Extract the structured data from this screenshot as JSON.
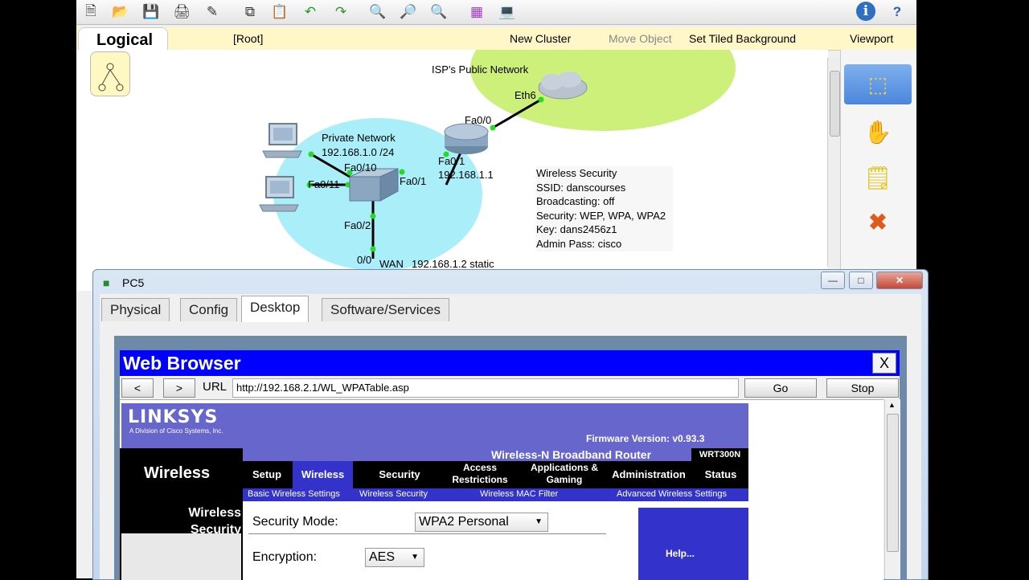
{
  "toolbar": {
    "icons": [
      "new-icon",
      "open-icon",
      "save-icon",
      "print-icon",
      "wizard-icon",
      "copy-icon",
      "paste-icon",
      "undo-icon",
      "redo-icon",
      "zoom-in-icon",
      "zoom-reset-icon",
      "zoom-out-icon",
      "palette-icon",
      "device-icon",
      "info-icon",
      "help-icon"
    ]
  },
  "navbar": {
    "mode": "Logical",
    "root": "[Root]",
    "new_cluster": "New Cluster",
    "move_object": "Move Object",
    "set_tiled_background": "Set Tiled Background",
    "viewport": "Viewport"
  },
  "topology": {
    "isp_label": "ISP's Public Network",
    "eth6": "Eth6",
    "fa00": "Fa0/0",
    "fa01_router": "Fa0/1",
    "router_ip": "192.168.1.1",
    "private_network": "Private Network",
    "private_subnet": "192.168.1.0 /24",
    "fa010": "Fa0/10",
    "fa011": "Fa0/11",
    "fa01_switch": "Fa0/1",
    "fa02": "Fa0/2",
    "port00": "0/0",
    "wan_label": "WAN",
    "wan_ip": "192.168.1.2 static",
    "wireless_info": [
      "Wireless Security",
      "SSID: danscourses",
      "Broadcasting: off",
      "Security: WEP, WPA, WPA2",
      "Key: dans2456z1",
      "Admin Pass: cisco"
    ],
    "colors": {
      "isp_cloud": "#ccf07a",
      "private_cloud": "#aaeefa",
      "link_dot": "#22dd22"
    }
  },
  "pc_window": {
    "title": "PC5",
    "tabs": [
      "Physical",
      "Config",
      "Desktop",
      "Software/Services"
    ],
    "active_tab": "Desktop"
  },
  "browser": {
    "title": "Web Browser",
    "close_label": "X",
    "back_label": "<",
    "forward_label": ">",
    "url_label": "URL",
    "url": "http://192.168.2.1/WL_WPATable.asp",
    "go_label": "Go",
    "stop_label": "Stop"
  },
  "linksys": {
    "logo": "LINKSYS",
    "logo_sub": "A Division of Cisco Systems, Inc.",
    "firmware": "Firmware Version: v0.93.3",
    "product": "Wireless-N Broadband Router",
    "model": "WRT300N",
    "section": "Wireless",
    "menu": [
      "Setup",
      "Wireless",
      "Security",
      "Access Restrictions",
      "Applications & Gaming",
      "Administration",
      "Status"
    ],
    "active_menu": "Wireless",
    "submenu": [
      "Basic Wireless Settings",
      "Wireless Security",
      "Wireless MAC Filter",
      "Advanced Wireless Settings"
    ],
    "sidebar_title": "Wireless Security",
    "security_mode_label": "Security Mode:",
    "security_mode_value": "WPA2 Personal",
    "encryption_label": "Encryption:",
    "encryption_value": "AES",
    "help_label": "Help...",
    "colors": {
      "header": "#6666cc",
      "dark": "#000000",
      "accent": "#3333cc"
    }
  }
}
